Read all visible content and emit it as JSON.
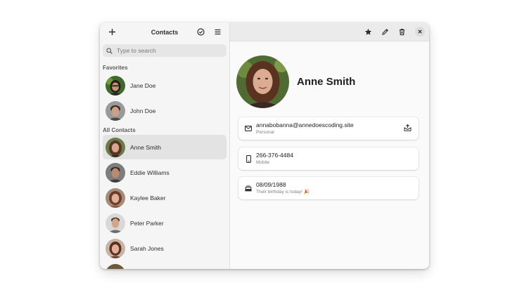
{
  "sidebar": {
    "title": "Contacts",
    "search_placeholder": "Type to search",
    "favorites_title": "Favorites",
    "favorites": [
      {
        "name": "Jane Doe"
      },
      {
        "name": "John Doe"
      }
    ],
    "all_title": "All Contacts",
    "contacts": [
      {
        "name": "Anne Smith",
        "selected": true
      },
      {
        "name": "Eddie Williams"
      },
      {
        "name": "Kaylee Baker"
      },
      {
        "name": "Peter Parker"
      },
      {
        "name": "Sarah Jones"
      }
    ]
  },
  "main": {
    "contact_name": "Anne Smith",
    "email": {
      "value": "annabobanna@annedoescoding.site",
      "label": "Personal"
    },
    "phone": {
      "value": "266-376-4484",
      "label": "Mobile"
    },
    "birthday": {
      "value": "08/09/1988",
      "label": "Their birthday is today! 🎉"
    }
  },
  "icons": {
    "add": "plus-icon",
    "select": "check-circle-icon",
    "menu": "hamburger-menu-icon",
    "search": "search-icon",
    "favorite": "star-icon",
    "edit": "pencil-icon",
    "delete": "trash-icon",
    "close": "close-icon",
    "email": "envelope-icon",
    "phone": "phone-icon",
    "birthday": "cake-icon",
    "send": "send-email-icon"
  },
  "colors": {
    "window_bg": "#fafafa",
    "sidebar_bg": "#f5f5f5",
    "selected_row": "#e3e3e3",
    "header_bg": "#ebebeb"
  }
}
